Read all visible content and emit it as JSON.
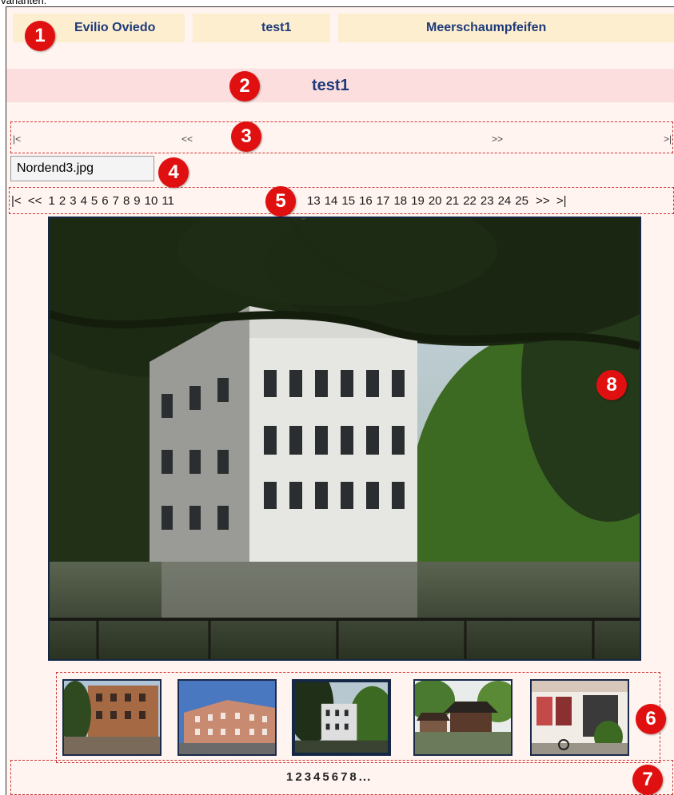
{
  "caption": "Varianten:",
  "nav": {
    "items": [
      "Evilio Oviedo",
      "test1",
      "Meerschaumpfeifen"
    ]
  },
  "title": "test1",
  "pager_top": {
    "first": "|<",
    "prev": "<<",
    "next": ">>",
    "last": ">|"
  },
  "filename": "Nordend3.jpg",
  "page_list": {
    "first": "|<",
    "prev": "<<",
    "pages_before": [
      "1",
      "2",
      "3",
      "4",
      "5",
      "6",
      "7",
      "8",
      "9",
      "10",
      "11"
    ],
    "pages_after": [
      "13",
      "14",
      "15",
      "16",
      "17",
      "18",
      "19",
      "20",
      "21",
      "22",
      "23",
      "24",
      "25"
    ],
    "next": ">>",
    "last": ">|"
  },
  "thumb_pages": [
    "1",
    "2",
    "3",
    "4",
    "5",
    "6",
    "7",
    "8",
    "..."
  ],
  "badges": [
    "1",
    "2",
    "3",
    "4",
    "5",
    "6",
    "7",
    "8"
  ],
  "colors": {
    "accent_blue": "#1e3a7a",
    "badge_red": "#e01010",
    "nav_bg": "#fdeecf",
    "title_bg": "#fddede",
    "page_bg": "#fff4f0"
  }
}
